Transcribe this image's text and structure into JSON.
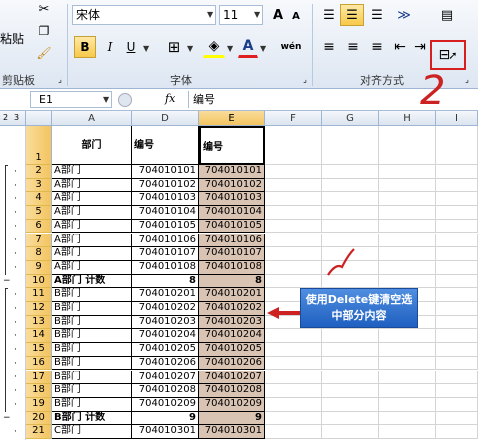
{
  "ribbon": {
    "paste_label": "粘贴",
    "clipboard_group": "剪贴板",
    "font_name": "宋体",
    "font_size": "11",
    "grow_font": "A",
    "shrink_font": "A",
    "bold": "B",
    "italic": "I",
    "underline": "U",
    "font_color": "A",
    "phonetic": "wén",
    "font_group": "字体",
    "align_group": "对齐方式"
  },
  "annotation_number": "2",
  "callout_text": "使用Delete键清空选中部分内容",
  "formula_bar": {
    "name_box": "E1",
    "fx": "fx",
    "formula": "编号"
  },
  "outline_levels": [
    "2",
    "3"
  ],
  "column_headers": [
    "A",
    "D",
    "E",
    "F",
    "G",
    "H",
    "I"
  ],
  "rows": [
    {
      "num": "1",
      "a": "部门",
      "d": "编号",
      "e": "编号",
      "header": true
    },
    {
      "num": "2",
      "a": "A部门",
      "d": "704010101",
      "e": "704010101"
    },
    {
      "num": "3",
      "a": "A部门",
      "d": "704010102",
      "e": "704010102"
    },
    {
      "num": "4",
      "a": "A部门",
      "d": "704010103",
      "e": "704010103"
    },
    {
      "num": "5",
      "a": "A部门",
      "d": "704010104",
      "e": "704010104"
    },
    {
      "num": "6",
      "a": "A部门",
      "d": "704010105",
      "e": "704010105"
    },
    {
      "num": "7",
      "a": "A部门",
      "d": "704010106",
      "e": "704010106"
    },
    {
      "num": "8",
      "a": "A部门",
      "d": "704010107",
      "e": "704010107"
    },
    {
      "num": "9",
      "a": "A部门",
      "d": "704010108",
      "e": "704010108"
    },
    {
      "num": "10",
      "a": "A部门 计数",
      "d": "8",
      "e": "8",
      "subtotal": true
    },
    {
      "num": "11",
      "a": "B部门",
      "d": "704010201",
      "e": "704010201"
    },
    {
      "num": "12",
      "a": "B部门",
      "d": "704010202",
      "e": "704010202"
    },
    {
      "num": "13",
      "a": "B部门",
      "d": "704010203",
      "e": "704010203"
    },
    {
      "num": "14",
      "a": "B部门",
      "d": "704010204",
      "e": "704010204"
    },
    {
      "num": "15",
      "a": "B部门",
      "d": "704010205",
      "e": "704010205"
    },
    {
      "num": "16",
      "a": "B部门",
      "d": "704010206",
      "e": "704010206"
    },
    {
      "num": "17",
      "a": "B部门",
      "d": "704010207",
      "e": "704010207"
    },
    {
      "num": "18",
      "a": "B部门",
      "d": "704010208",
      "e": "704010208"
    },
    {
      "num": "19",
      "a": "B部门",
      "d": "704010209",
      "e": "704010209"
    },
    {
      "num": "20",
      "a": "B部门 计数",
      "d": "9",
      "e": "9",
      "subtotal": true
    },
    {
      "num": "21",
      "a": "C部门",
      "d": "704010301",
      "e": "704010301"
    }
  ],
  "colors": {
    "selection": "#d9c3b3",
    "annotation_red": "#cc2222",
    "callout_bg": "#2a6fcf",
    "header_orange": "#f3c45f"
  }
}
